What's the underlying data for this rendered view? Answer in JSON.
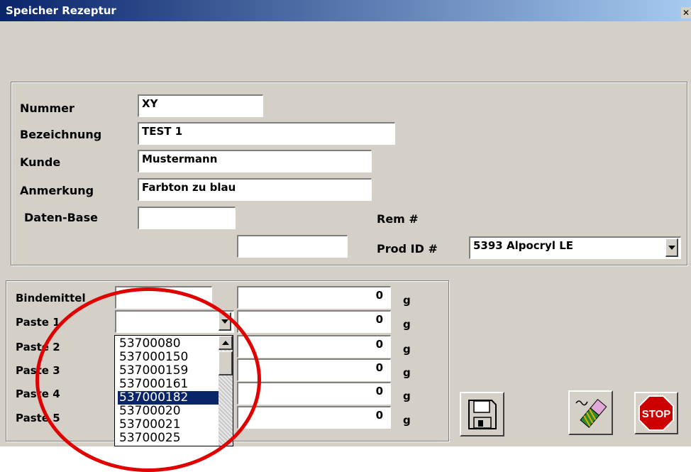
{
  "window": {
    "title": "Speicher Rezeptur",
    "close_glyph": "✕"
  },
  "header_group": {
    "nummer": {
      "label": "Nummer",
      "value": "XY"
    },
    "bezeichnung": {
      "label": "Bezeichnung",
      "value": "TEST 1"
    },
    "kunde": {
      "label": "Kunde",
      "value": "Mustermann"
    },
    "anmerkung": {
      "label": "Anmerkung",
      "value": "Farbton zu blau"
    },
    "datenbase": {
      "label": "Daten-Base",
      "value": ""
    },
    "extra_field": {
      "value": ""
    },
    "rem": {
      "label": "Rem #"
    },
    "prodid": {
      "label": "Prod ID #",
      "value": "5393 Alpocryl LE"
    }
  },
  "ingredients": {
    "unit": "g",
    "rows": [
      {
        "label": "Bindemittel",
        "selector": "",
        "amount": "0"
      },
      {
        "label": "Paste 1",
        "selector": "",
        "amount": "0"
      },
      {
        "label": "Paste 2",
        "amount": "0"
      },
      {
        "label": "Paste 3",
        "amount": "0"
      },
      {
        "label": "Paste 4",
        "amount": "0"
      },
      {
        "label": "Paste 5",
        "amount": "0"
      }
    ]
  },
  "dropdown_list": {
    "items": [
      "53700080",
      "537000150",
      "537000159",
      "537000161",
      "537000182",
      "53700020",
      "53700021",
      "53700025"
    ],
    "selected": "537000182"
  },
  "buttons": {
    "save": {
      "icon": "floppy-disk-icon"
    },
    "clear": {
      "icon": "eraser-icon"
    },
    "stop": {
      "icon": "stop-sign-icon",
      "label": "STOP"
    }
  },
  "annotation": {
    "color": "#e00000"
  }
}
